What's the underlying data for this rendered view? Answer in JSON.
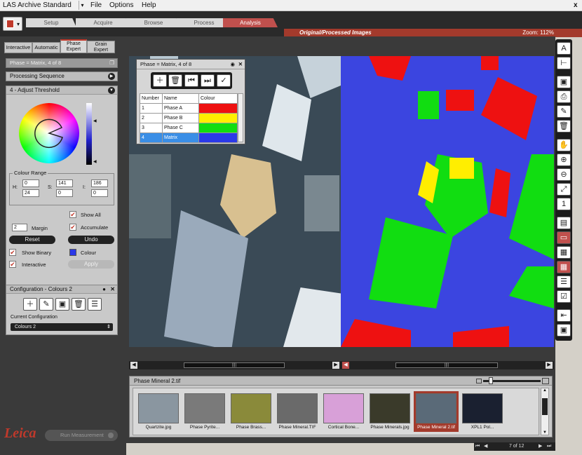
{
  "app": {
    "title": "LAS Archive Standard",
    "menu": [
      "File",
      "Options",
      "Help"
    ],
    "close": "x"
  },
  "nav": {
    "tabs": [
      "Setup",
      "Acquire",
      "Browse",
      "Process",
      "Analysis"
    ]
  },
  "view": {
    "title": "Original/Processed Images",
    "zoom": "Zoom: 112%"
  },
  "left": {
    "tabs": [
      "Interactive",
      "Automatic",
      "Phase Expert",
      "Grain Expert"
    ],
    "phase_header": "Phase = Matrix, 4 of 8",
    "processing": "Processing Sequence",
    "threshold": "4 - Adjust Threshold",
    "colour_range": "Colour Range",
    "h_label": "H:",
    "s_label": "S:",
    "i_label": "I:",
    "h_vals": [
      "0",
      "24"
    ],
    "s_vals": [
      "141",
      "0"
    ],
    "i_vals": [
      "186",
      "0"
    ],
    "show_all": "Show All",
    "margin_val": "2",
    "margin": "Margin",
    "accumulate": "Accumulate",
    "reset": "Reset",
    "undo": "Undo",
    "show_binary": "Show Binary",
    "colour": "Colour",
    "interactive": "Interactive",
    "apply": "Apply",
    "config_header": "Configuration - Colours 2",
    "current_config": "Current Configuration",
    "config_value": "Colours 2",
    "logo": "Leica",
    "run": "Run Measurement"
  },
  "popup": {
    "title": "Phase = Matrix, 4 of 8",
    "cols": [
      "Number",
      "Name",
      "Colour"
    ],
    "rows": [
      {
        "num": "1",
        "name": "Phase A",
        "color": "#ee1111"
      },
      {
        "num": "2",
        "name": "Phase B",
        "color": "#ffee00"
      },
      {
        "num": "3",
        "name": "Phase C",
        "color": "#11dd11"
      },
      {
        "num": "4",
        "name": "Matrix",
        "color": "#2b39e8"
      }
    ]
  },
  "gallery": {
    "title": "Phase Mineral 2.tif",
    "page": "7 of 12",
    "items": [
      {
        "label": "Quartzite.jpg",
        "bg": "#8a96a0"
      },
      {
        "label": "Phase Pyrite...",
        "bg": "#7a7a7a"
      },
      {
        "label": "Phase Brass...",
        "bg": "#8a8a3a"
      },
      {
        "label": "Phase Mineral.TIF",
        "bg": "#6a6a6a"
      },
      {
        "label": "Cortical Bone...",
        "bg": "#d8a0d8"
      },
      {
        "label": "Phase Minerals.jpg",
        "bg": "#3a3a2a"
      },
      {
        "label": "Phase Mineral 2.tif",
        "bg": "#5a6a78"
      },
      {
        "label": "XPL1 Pol...",
        "bg": "#1a2030"
      }
    ]
  }
}
